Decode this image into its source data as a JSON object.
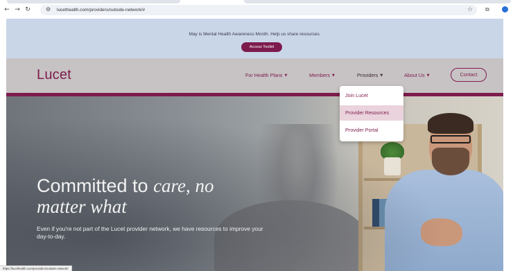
{
  "browser": {
    "url": "lucethealth.com/providers/outside-network/#",
    "status_url": "https://lucethealth.com/providers/outside-network/"
  },
  "banner": {
    "text": "May is Mental Health Awareness Month. Help us share resources.",
    "button_label": "Access Toolkit"
  },
  "navbar": {
    "logo": "Lucet",
    "items": [
      {
        "label": "For Health Plans"
      },
      {
        "label": "Members"
      },
      {
        "label": "Providers"
      },
      {
        "label": "About Us"
      }
    ],
    "contact_label": "Contact"
  },
  "dropdown": {
    "items": [
      {
        "label": "Join Lucet"
      },
      {
        "label": "Provider Resources"
      },
      {
        "label": "Provider Portal"
      }
    ]
  },
  "hero": {
    "title_plain": "Committed to ",
    "title_italic_1": "care, no",
    "title_italic_2": "matter what",
    "subtitle": "Even if you're not part of the Lucet provider network, we have resources to improve your day-to-day."
  },
  "colors": {
    "brand": "#7d1b4d",
    "banner_bg": "#c9d6e8",
    "nav_bg": "#c7c3c4"
  }
}
